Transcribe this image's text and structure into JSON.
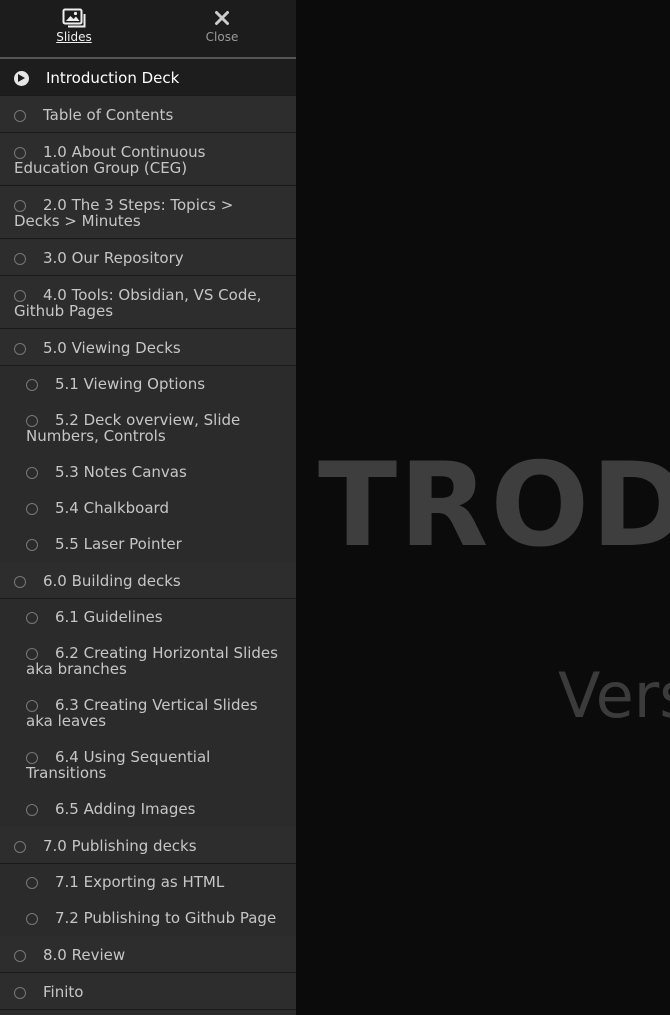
{
  "slide": {
    "title_fragment": "TRODU",
    "subtitle_fragment": "Vers"
  },
  "toolbar": {
    "slides_label": "Slides",
    "close_label": "Close"
  },
  "menu": {
    "items": [
      {
        "label": "Introduction Deck",
        "level": 0,
        "active": true
      },
      {
        "label": "Table of Contents",
        "level": 0
      },
      {
        "label": "1.0 About Continuous Education Group (CEG)",
        "level": 0
      },
      {
        "label": "2.0 The 3 Steps: Topics > Decks > Minutes",
        "level": 0
      },
      {
        "label": "3.0 Our Repository",
        "level": 0
      },
      {
        "label": "4.0 Tools: Obsidian, VS Code, Github Pages",
        "level": 0
      },
      {
        "label": "5.0 Viewing Decks",
        "level": 0
      },
      {
        "label": "5.1 Viewing Options",
        "level": 1
      },
      {
        "label": "5.2 Deck overview, Slide Numbers, Controls",
        "level": 1
      },
      {
        "label": "5.3 Notes Canvas",
        "level": 1
      },
      {
        "label": "5.4 Chalkboard",
        "level": 1
      },
      {
        "label": "5.5 Laser Pointer",
        "level": 1
      },
      {
        "label": "6.0 Building decks",
        "level": 0
      },
      {
        "label": "6.1 Guidelines",
        "level": 1
      },
      {
        "label": "6.2 Creating Horizontal Slides aka branches",
        "level": 1
      },
      {
        "label": "6.3 Creating Vertical Slides aka leaves",
        "level": 1
      },
      {
        "label": "6.4 Using Sequential Transitions",
        "level": 1
      },
      {
        "label": "6.5 Adding Images",
        "level": 1
      },
      {
        "label": "7.0 Publishing decks",
        "level": 0
      },
      {
        "label": "7.1 Exporting as HTML",
        "level": 1
      },
      {
        "label": "7.2 Publishing to Github Page",
        "level": 1
      },
      {
        "label": "8.0 Review",
        "level": 0
      },
      {
        "label": "Finito",
        "level": 0
      }
    ]
  }
}
